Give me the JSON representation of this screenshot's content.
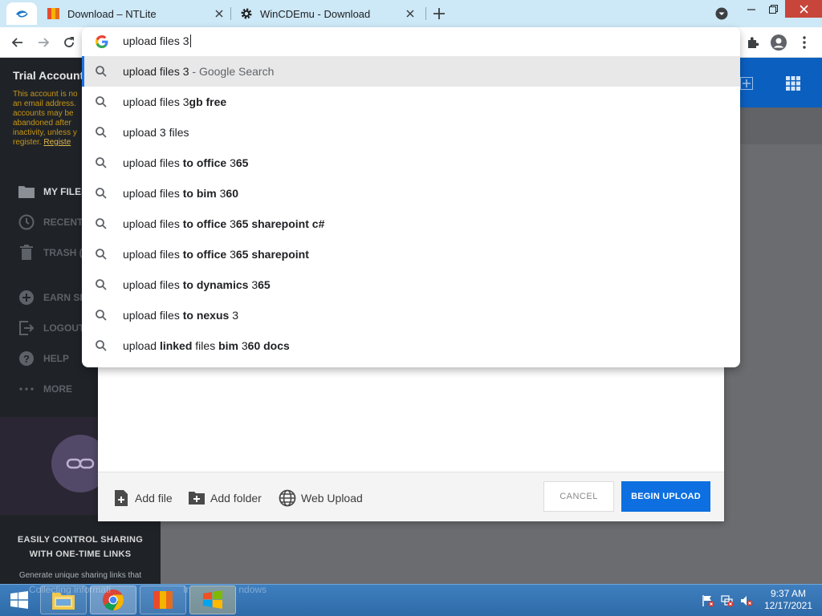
{
  "browser": {
    "tabs": [
      {
        "title": "Download – NTLite",
        "favicon": "ntlite-icon"
      },
      {
        "title": "WinCDEmu - Download",
        "favicon": "gear-icon"
      }
    ],
    "omnibox": {
      "query": "upload files 3",
      "suggestions": [
        {
          "parts": [
            {
              "t": "upload files 3",
              "b": false
            }
          ],
          "suffix": " - Google Search",
          "selected": true
        },
        {
          "parts": [
            {
              "t": "upload files 3",
              "b": false
            },
            {
              "t": "gb free",
              "b": true
            }
          ]
        },
        {
          "parts": [
            {
              "t": "upload 3 files",
              "b": false
            }
          ]
        },
        {
          "parts": [
            {
              "t": "upload files ",
              "b": false
            },
            {
              "t": "to office ",
              "b": true
            },
            {
              "t": "3",
              "b": false
            },
            {
              "t": "65",
              "b": true
            }
          ]
        },
        {
          "parts": [
            {
              "t": "upload files ",
              "b": false
            },
            {
              "t": "to bim ",
              "b": true
            },
            {
              "t": "3",
              "b": false
            },
            {
              "t": "60",
              "b": true
            }
          ]
        },
        {
          "parts": [
            {
              "t": "upload files ",
              "b": false
            },
            {
              "t": "to office ",
              "b": true
            },
            {
              "t": "3",
              "b": false
            },
            {
              "t": "65 sharepoint c#",
              "b": true
            }
          ]
        },
        {
          "parts": [
            {
              "t": "upload files ",
              "b": false
            },
            {
              "t": "to office ",
              "b": true
            },
            {
              "t": "3",
              "b": false
            },
            {
              "t": "65 sharepoint",
              "b": true
            }
          ]
        },
        {
          "parts": [
            {
              "t": "upload files ",
              "b": false
            },
            {
              "t": "to dynamics ",
              "b": true
            },
            {
              "t": "3",
              "b": false
            },
            {
              "t": "65",
              "b": true
            }
          ]
        },
        {
          "parts": [
            {
              "t": "upload files ",
              "b": false
            },
            {
              "t": "to nexus ",
              "b": true
            },
            {
              "t": "3",
              "b": false
            }
          ]
        },
        {
          "parts": [
            {
              "t": "upload ",
              "b": false
            },
            {
              "t": "linked",
              "b": true
            },
            {
              "t": " files ",
              "b": false
            },
            {
              "t": "bim ",
              "b": true
            },
            {
              "t": "3",
              "b": false
            },
            {
              "t": "60 docs",
              "b": true
            }
          ]
        }
      ]
    }
  },
  "site": {
    "trial_title": "Trial Account",
    "trial_text_lines": [
      "This account is no",
      "an email address.",
      "accounts may be",
      "abandoned after",
      "inactivity, unless y",
      "register."
    ],
    "trial_register_link": "Registe",
    "nav": [
      {
        "label": "MY FILES",
        "icon": "folder-icon",
        "active": true
      },
      {
        "label": "RECENT",
        "icon": "clock-icon",
        "active": false
      },
      {
        "label": "TRASH (0",
        "icon": "trash-icon",
        "active": false
      },
      {
        "label": "EARN SPA",
        "icon": "plus-circle-icon",
        "active": false
      },
      {
        "label": "LOGOUT",
        "icon": "logout-icon",
        "active": false
      },
      {
        "label": "HELP",
        "icon": "help-icon",
        "active": false
      },
      {
        "label": "MORE",
        "icon": "more-icon",
        "active": false
      }
    ],
    "promo_title_1": "EASILY CONTROL SHARING",
    "promo_title_2": "WITH ONE-TIME LINKS",
    "promo_text": "Generate unique sharing links that"
  },
  "upload_dialog": {
    "add_file": "Add file",
    "add_folder": "Add folder",
    "web_upload": "Web Upload",
    "cancel": "CANCEL",
    "begin": "BEGIN UPLOAD"
  },
  "taskbar": {
    "overlay_text_1": "Collecting informati",
    "overlay_text_2": "Ir",
    "overlay_text_3": "ndows",
    "time": "9:37 AM",
    "date": "12/17/2021"
  },
  "colors": {
    "accent": "#1a73e8",
    "site_blue": "#0b5fbf",
    "begin_button": "#0d6fe0"
  }
}
